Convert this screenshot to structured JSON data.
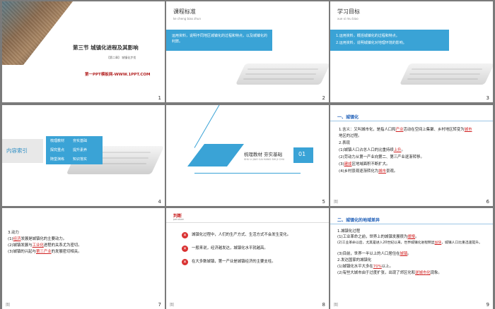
{
  "slides": [
    {
      "num": "1",
      "title": "第三节   城镇化进程及其影响",
      "subtitle": "【第二章】  城镇化步伐",
      "site": "第一PPT模板网-WWW.1PPT.COM"
    },
    {
      "num": "2",
      "title": "课程标准",
      "subtitle": "ke cheng biao zhun",
      "body": "运用资料，说明不同地区城镇化的过程和特点，以及城镇化的利弊。"
    },
    {
      "num": "3",
      "title": "学习目标",
      "subtitle": "xue xi mu biao",
      "items": [
        "1.运用资料，概括城镇化的过程和特点。",
        "2.运用资料，说明城镇化对地理环境的影响。"
      ]
    },
    {
      "num": "4",
      "title": "内容索引",
      "menu": [
        "梳理教材",
        "夯实基础",
        "探究重点",
        "提升素养",
        "随堂演练",
        "知识落实"
      ]
    },
    {
      "num": "5",
      "title": "梳理教材   夯实基础",
      "subtitle": "SHU LI JIAO CAI   HANG SHI JI CHU",
      "index": "01"
    },
    {
      "num": "6",
      "section": "一、城镇化",
      "lines": [
        "1.含义：又叫城市化，是指人口和",
        "产业",
        "活动在空间上集聚、乡村地区转变为",
        "城市",
        "地区的过程。",
        "2.表现",
        "(1)城镇人口占总人口的比重持续",
        "上升",
        "。",
        "(2)劳动力从第一产业向第二、第三产业逐渐转移。",
        "(3)",
        "建成",
        "区地域面积不断扩大。",
        "(4)乡村景观逐渐转化为",
        "城市",
        "景观。"
      ]
    },
    {
      "num": "7",
      "lines": [
        "3.动力",
        "(1)",
        "经济",
        "发展是城镇化的主要动力。",
        "(2)城镇发展与",
        "工业化",
        "进程的关系尤为密切。",
        "(3)城镇的兴起与",
        "第三产业",
        "的发展密切相关。"
      ]
    },
    {
      "num": "8",
      "title": "判断",
      "subtitle": "panduan",
      "judgements": [
        "城镇化过程中，人们的生产方式、生活方式不会发生变化。",
        "一般来说，经济越发达，城镇化水平就越高。",
        "在大多数城镇，第一产业是城镇经济的主要支柱。"
      ]
    },
    {
      "num": "9",
      "section": "二、城镇化的地域差异",
      "lines": [
        "1.城镇化过程",
        "(1)工业革命之前，世界上的城镇发展很为",
        "缓慢",
        "。",
        "(2)工业革命以后，尤其是进入20世纪以来，世界城镇化进程明显",
        "加快",
        "，城镇人口比重迅速提升。",
        "(3)目前，世界一半以上的人口居住在",
        "城镇",
        "。",
        "2.发达国家的城镇化",
        "(1)城镇化水平大多",
        "在",
        "70%",
        "以上。",
        "(2)有些大城市由于过度扩张，出现了郊区化和",
        "逆城市化",
        "现象。"
      ]
    }
  ],
  "footer_symbol": "图"
}
